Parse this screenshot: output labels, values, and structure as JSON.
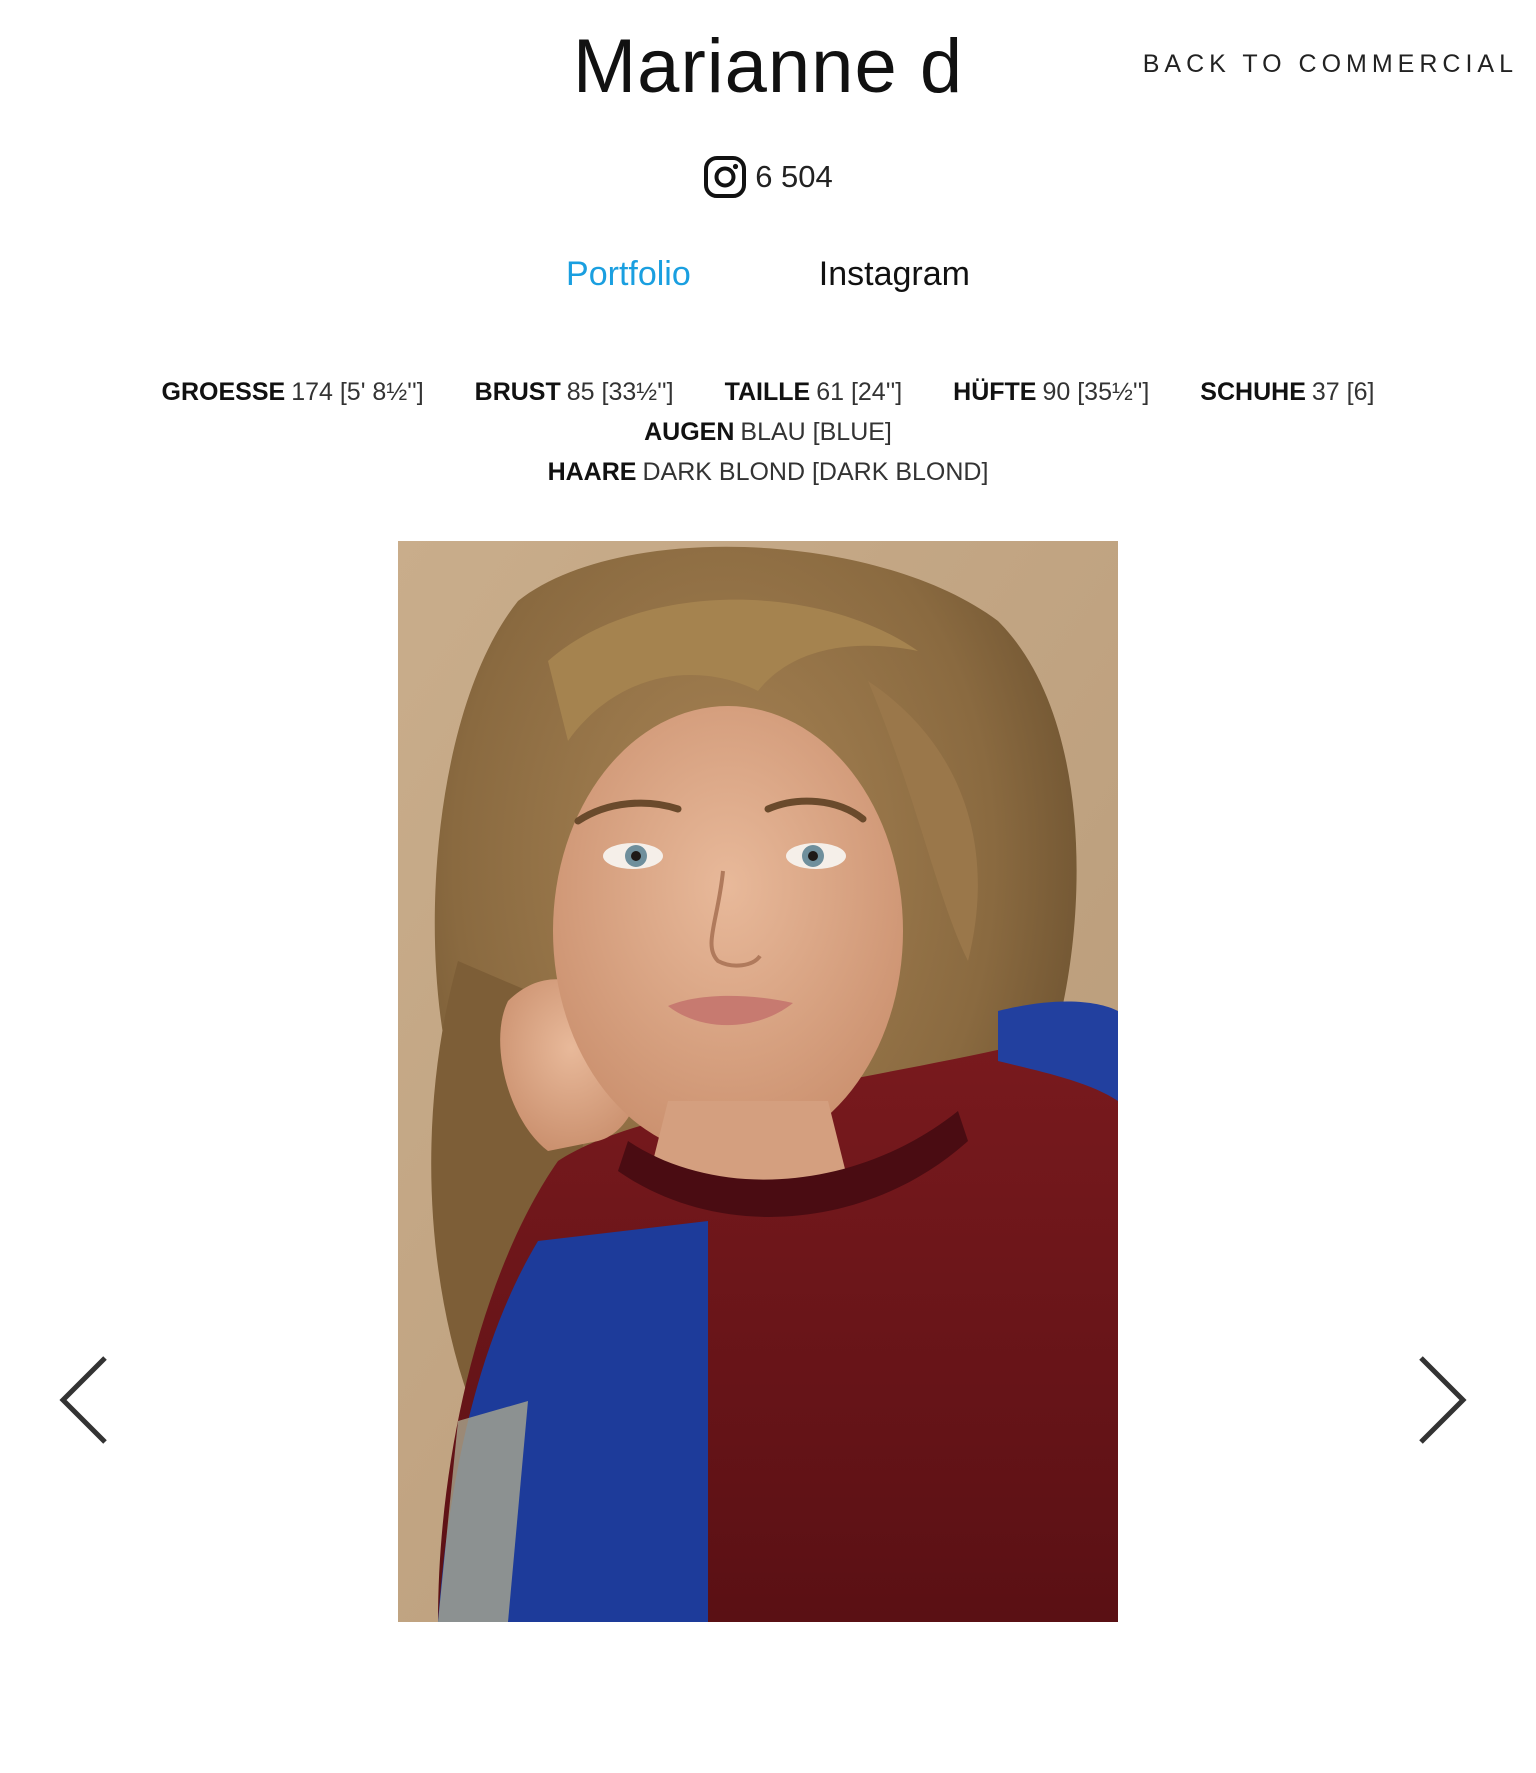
{
  "model": {
    "name": "Marianne d"
  },
  "nav": {
    "back_label": "BACK TO COMMERCIAL"
  },
  "instagram": {
    "followers": "6 504",
    "icon": "instagram-icon"
  },
  "tabs": [
    {
      "label": "Portfolio",
      "active": true
    },
    {
      "label": "Instagram",
      "active": false
    }
  ],
  "measurements": [
    {
      "key": "GROESSE",
      "value": "174 [5' 8½'']"
    },
    {
      "key": "BRUST",
      "value": "85 [33½'']"
    },
    {
      "key": "TAILLE",
      "value": "61 [24'']"
    },
    {
      "key": "HÜFTE",
      "value": "90 [35½'']"
    },
    {
      "key": "SCHUHE",
      "value": "37 [6]"
    },
    {
      "key": "AUGEN",
      "value": "BLAU [BLUE]"
    },
    {
      "key": "HAARE",
      "value": "DARK BLOND [DARK BLOND]"
    }
  ],
  "gallery": {
    "prev_icon": "chevron-left-icon",
    "next_icon": "chevron-right-icon"
  },
  "colors": {
    "accent": "#1a9fe0",
    "text": "#111111",
    "background": "#ffffff"
  }
}
